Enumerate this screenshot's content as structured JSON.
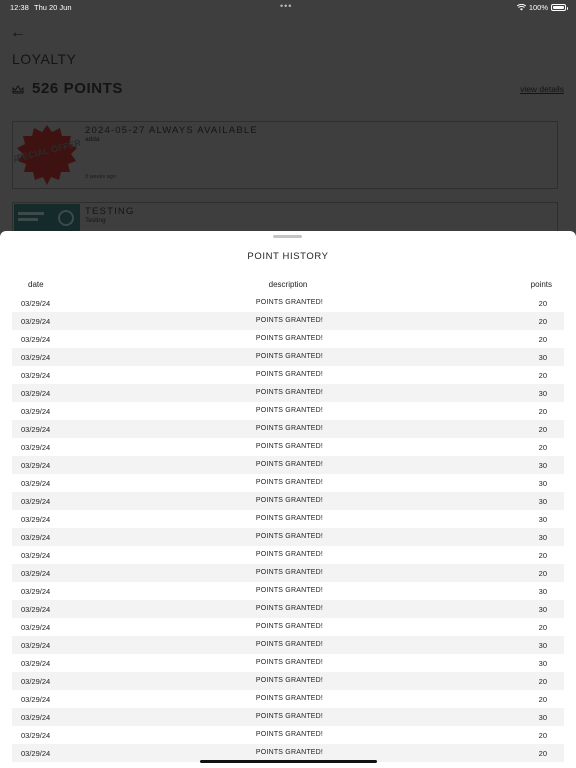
{
  "status_bar": {
    "time": "12:38",
    "date": "Thu 20 Jun",
    "dots": "•••",
    "battery": "100%"
  },
  "page": {
    "back_icon": "←",
    "title": "LOYALTY",
    "points_total": "526 POINTS",
    "view_details": "view details",
    "offers": [
      {
        "title": "2024-05-27 ALWAYS AVAILABLE",
        "subtitle": "adda",
        "time": "3 weeks ago",
        "badge_text": "SPECIAL OFFER"
      },
      {
        "title": "TESTING",
        "subtitle": "Testing"
      }
    ]
  },
  "sheet": {
    "title": "POINT HISTORY",
    "headers": {
      "date": "date",
      "description": "description",
      "points": "points"
    },
    "rows": [
      {
        "date": "03/29/24",
        "description": "POINTS GRANTED!",
        "points": "20"
      },
      {
        "date": "03/29/24",
        "description": "POINTS GRANTED!",
        "points": "20"
      },
      {
        "date": "03/29/24",
        "description": "POINTS GRANTED!",
        "points": "20"
      },
      {
        "date": "03/29/24",
        "description": "POINTS GRANTED!",
        "points": "30"
      },
      {
        "date": "03/29/24",
        "description": "POINTS GRANTED!",
        "points": "20"
      },
      {
        "date": "03/29/24",
        "description": "POINTS GRANTED!",
        "points": "30"
      },
      {
        "date": "03/29/24",
        "description": "POINTS GRANTED!",
        "points": "20"
      },
      {
        "date": "03/29/24",
        "description": "POINTS GRANTED!",
        "points": "20"
      },
      {
        "date": "03/29/24",
        "description": "POINTS GRANTED!",
        "points": "20"
      },
      {
        "date": "03/29/24",
        "description": "POINTS GRANTED!",
        "points": "30"
      },
      {
        "date": "03/29/24",
        "description": "POINTS GRANTED!",
        "points": "30"
      },
      {
        "date": "03/29/24",
        "description": "POINTS GRANTED!",
        "points": "30"
      },
      {
        "date": "03/29/24",
        "description": "POINTS GRANTED!",
        "points": "30"
      },
      {
        "date": "03/29/24",
        "description": "POINTS GRANTED!",
        "points": "30"
      },
      {
        "date": "03/29/24",
        "description": "POINTS GRANTED!",
        "points": "20"
      },
      {
        "date": "03/29/24",
        "description": "POINTS GRANTED!",
        "points": "20"
      },
      {
        "date": "03/29/24",
        "description": "POINTS GRANTED!",
        "points": "30"
      },
      {
        "date": "03/29/24",
        "description": "POINTS GRANTED!",
        "points": "30"
      },
      {
        "date": "03/29/24",
        "description": "POINTS GRANTED!",
        "points": "20"
      },
      {
        "date": "03/29/24",
        "description": "POINTS GRANTED!",
        "points": "30"
      },
      {
        "date": "03/29/24",
        "description": "POINTS GRANTED!",
        "points": "30"
      },
      {
        "date": "03/29/24",
        "description": "POINTS GRANTED!",
        "points": "20"
      },
      {
        "date": "03/29/24",
        "description": "POINTS GRANTED!",
        "points": "20"
      },
      {
        "date": "03/29/24",
        "description": "POINTS GRANTED!",
        "points": "30"
      },
      {
        "date": "03/29/24",
        "description": "POINTS GRANTED!",
        "points": "20"
      },
      {
        "date": "03/29/24",
        "description": "POINTS GRANTED!",
        "points": "20"
      }
    ]
  }
}
